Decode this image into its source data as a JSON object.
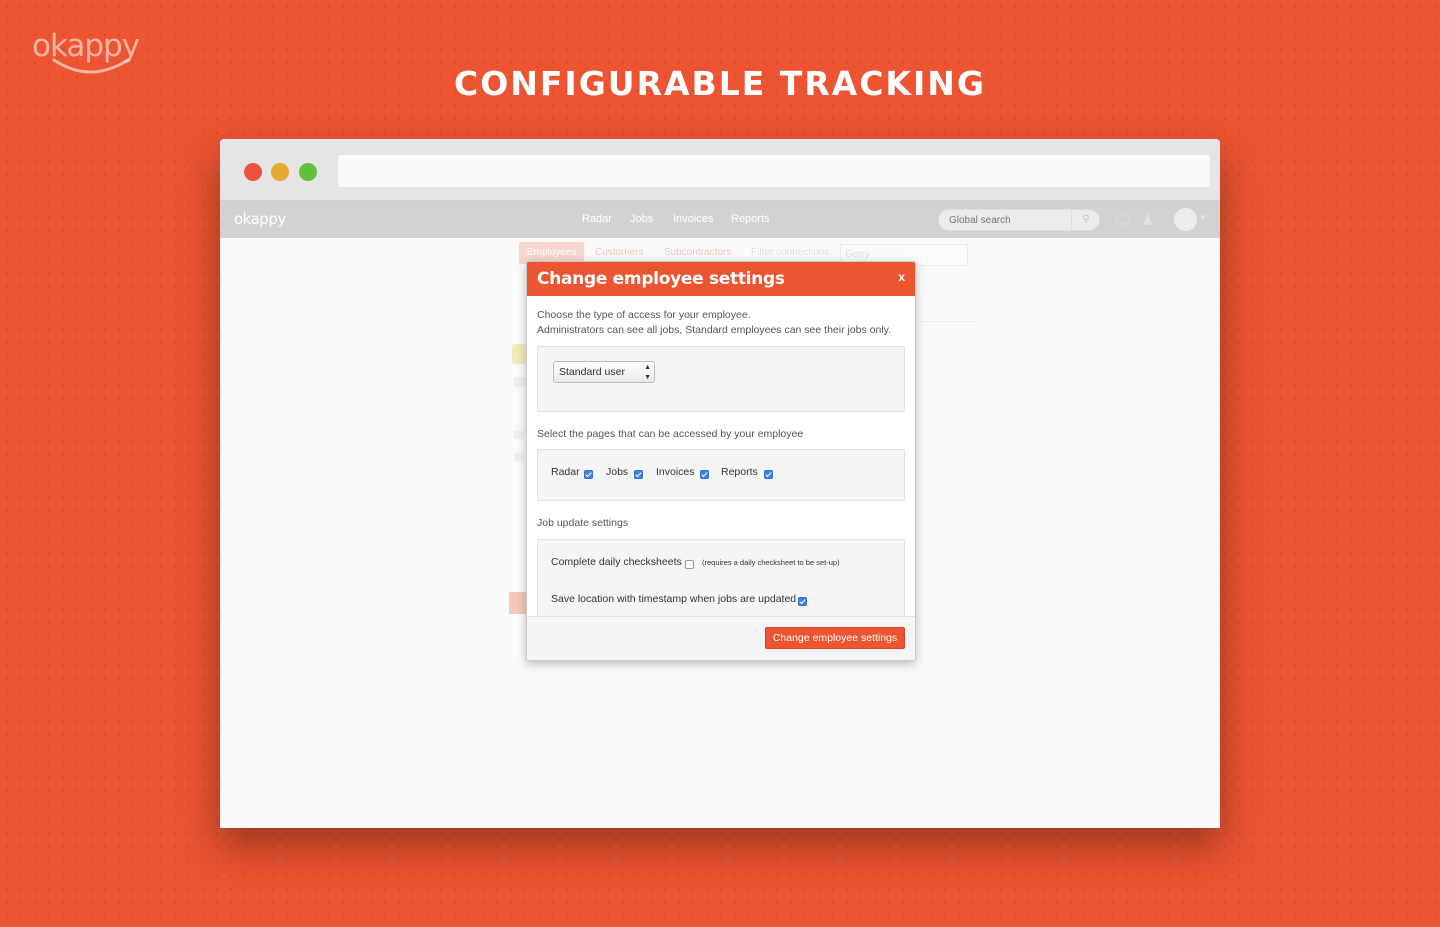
{
  "brand": {
    "logo_text": "okappy",
    "headline": "CONFIGURABLE TRACKING"
  },
  "app": {
    "logo_text": "okappy",
    "nav": [
      {
        "label": "Radar"
      },
      {
        "label": "Jobs"
      },
      {
        "label": "Invoices"
      },
      {
        "label": "Reports"
      }
    ],
    "search_placeholder": "Global search"
  },
  "background_page": {
    "tabs": [
      {
        "label": "Employees"
      },
      {
        "label": "Customers"
      },
      {
        "label": "Subcontractors"
      }
    ],
    "filter_label": "Filter connections:",
    "filter_value": "Gerry"
  },
  "modal": {
    "title": "Change employee settings",
    "close_label": "x",
    "intro_line1": "Choose the type of access for your employee.",
    "intro_line2": "Administrators can see all jobs, Standard employees can see their jobs only.",
    "access_select_value": "Standard user",
    "pages_heading": "Select the pages that can be accessed by your employee",
    "pages": [
      {
        "label": "Radar",
        "checked": true
      },
      {
        "label": "Jobs",
        "checked": true
      },
      {
        "label": "Invoices",
        "checked": true
      },
      {
        "label": "Reports",
        "checked": true
      }
    ],
    "job_update_heading": "Job update settings",
    "checksheets_label": "Complete daily checksheets",
    "checksheets_checked": false,
    "checksheets_note": "(requires a daily checksheet to be set-up)",
    "location_label": "Save location with timestamp when jobs are updated",
    "location_checked": true,
    "submit_label": "Change employee settings"
  },
  "colors": {
    "brand_orange": "#ec5432",
    "checkbox_blue": "#3d86e8"
  }
}
